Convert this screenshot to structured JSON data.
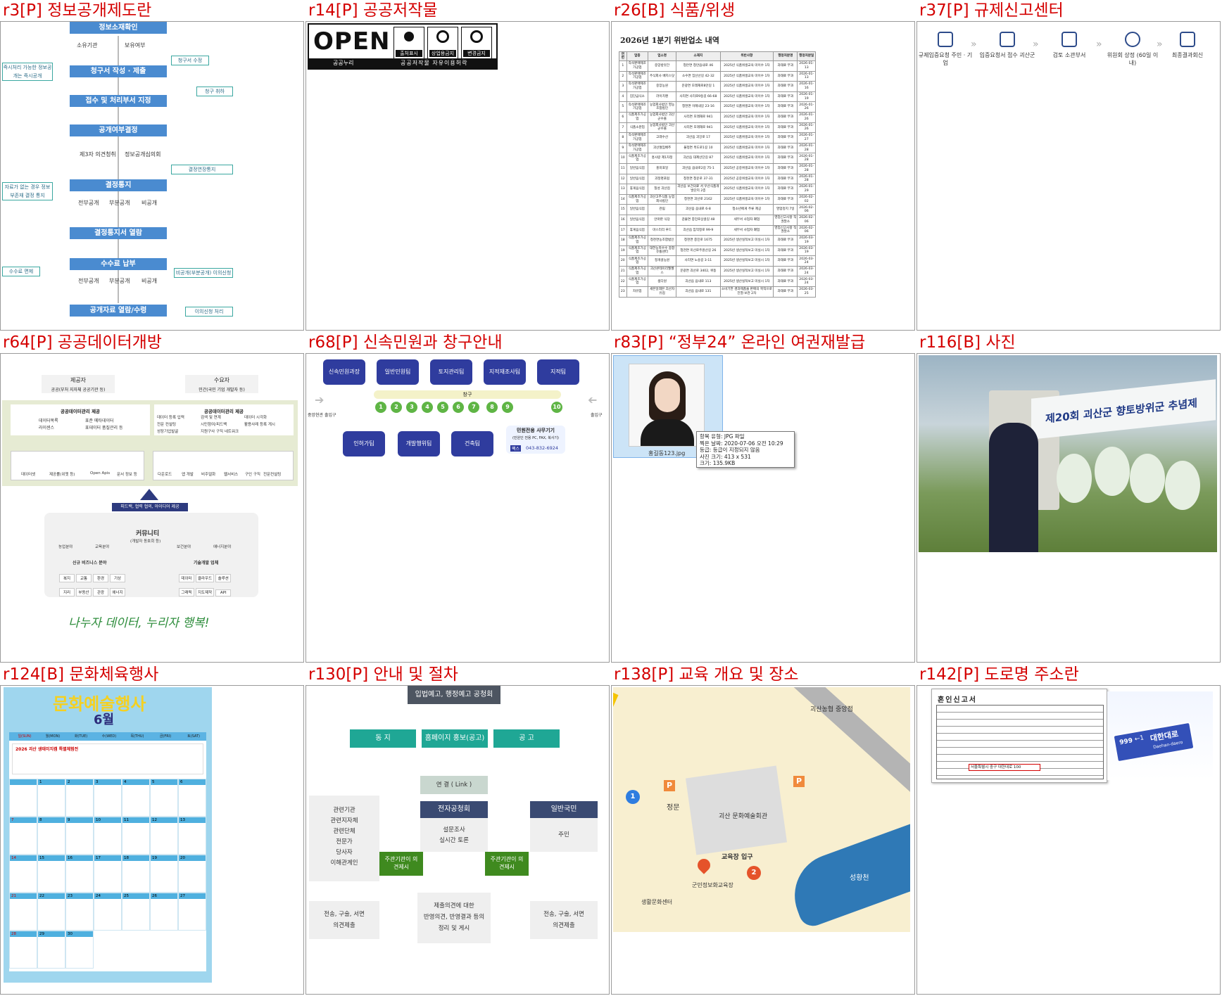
{
  "cells": {
    "r3": {
      "title": "r3[P] 정보공개제도란"
    },
    "r14": {
      "title": "r14[P] 공공저작물"
    },
    "r26": {
      "title": "r26[B] 식품/위생"
    },
    "r37": {
      "title": "r37[P] 규제신고센터"
    },
    "r64": {
      "title": "r64[P] 공공데이터개방"
    },
    "r68": {
      "title": "r68[P] 신속민원과 창구안내"
    },
    "r83": {
      "title": "r83[P] “정부24” 온라인 여권재발급"
    },
    "r116": {
      "title": "r116[B] 사진"
    },
    "r124": {
      "title": "r124[B] 문화체육행사"
    },
    "r130": {
      "title": "r130[P] 안내 및 절차"
    },
    "r138": {
      "title": "r138[P] 교육 개요 및 장소"
    },
    "r142": {
      "title": "r142[P] 도로명 주소란"
    }
  },
  "r3": {
    "steps": [
      "정보소재확인",
      "청구서 작성 · 제출",
      "접수 및 처리부서 지정",
      "공개여부결정",
      "결정통지",
      "결정통지서 열람",
      "수수료 납부",
      "공개자료 열람/수령"
    ],
    "sub1": [
      "소유기관",
      "보유여부"
    ],
    "sub2": [
      "제3자 의견청취",
      "정보공개심의회"
    ],
    "sub3": [
      "전부공개",
      "부분공개",
      "비공개"
    ],
    "sub4": [
      "전부공개",
      "부분공개",
      "비공개"
    ],
    "right": [
      "청구서 수정",
      "청구 취하",
      "결정연장통지",
      "비공개(부분공개) 이의신청",
      "이의신청 처리"
    ],
    "left": [
      "즉시처리 가능한 정보공개는 즉시공개",
      "자료가 없는 경우 정보부존재 결정 통지",
      "수수료 면제"
    ]
  },
  "r14": {
    "open": "OPEN",
    "nuri": "공공누리",
    "badges": [
      "출처표시",
      "상업용금지",
      "변경금지"
    ],
    "desc": "공공저작물 자유이용허락"
  },
  "r26": {
    "heading": "2026년 1분기 위반업소 내역",
    "headers": [
      "연번",
      "업종",
      "업소명",
      "소재지",
      "위반사항",
      "행정처분명",
      "행정처분일"
    ],
    "rows": [
      [
        "1",
        "즉석판매제조가공업",
        "중앙방앗간",
        "청안면 청안읍내로 46",
        "2025년 식품위생교육 미이수 1차",
        "과태료 부과",
        "2026-01-13"
      ],
      [
        "2",
        "즉석판매제조가공업",
        "주식회사 베지스닷",
        "소수면 집산산길 42-32",
        "2025년 식품위생교육 미이수 1차",
        "과태료 부과",
        "2026-01-13"
      ],
      [
        "3",
        "즉석판매제조가공업",
        "중앙농원",
        "문광면 모래재로8안길 1",
        "2025년 식품위생교육 미이수 1차",
        "과태료 부과",
        "2026-01-16"
      ],
      [
        "4",
        "집단급식소",
        "라이치랜",
        "사리면 사리로9동길 66-68",
        "2025년 식품위생교육 미이수 1차",
        "과태료 부과",
        "2026-01-19"
      ],
      [
        "5",
        "즉석판매제조가공업",
        "농업회사법인 영농조합법인",
        "청천면 이례내길 23-16",
        "2025년 식품위생교육 미이수 1차",
        "과태료 부과",
        "2026-01-26"
      ],
      [
        "6",
        "식품제조가공업",
        "농업회사법인 괴산군수출",
        "사리면 모래재로 941",
        "2025년 식품위생교육 미이수 1차",
        "과태료 부과",
        "2026-01-26"
      ],
      [
        "7",
        "식품소분업",
        "농업회사법인 괴산군수출",
        "사리면 모래재로 941",
        "2025년 식품위생교육 미이수 1차",
        "과태료 부과",
        "2026-01-26"
      ],
      [
        "8",
        "즉석판매제조가공업",
        "고래수산",
        "괴산읍 괴강로 17",
        "2025년 식품위생교육 미이수 1차",
        "과태료 부과",
        "2026-01-27"
      ],
      [
        "9",
        "즉석판매제조가공업",
        "괴산절임배추",
        "불정면 목도로1길 10",
        "2025년 식품위생교육 미이수 1차",
        "과태료 부과",
        "2026-01-28"
      ],
      [
        "10",
        "식품제조가공업",
        "홍사랑 제1차정",
        "괴산읍 대제산단길 87",
        "2025년 식품위생교육 미이수 1차",
        "과태료 부과",
        "2026-01-28"
      ],
      [
        "11",
        "일반음식점",
        "홍미표일",
        "괴산읍 읍내로2길 75-1",
        "2025년 공중위생교육 미이수 1차",
        "과태료 부과",
        "2026-01-28"
      ],
      [
        "12",
        "일반음식점",
        "괴정명포럼",
        "청천면 청운로 37-31",
        "2025년 공중위생교육 미이수 1차",
        "과태료 부과",
        "2026-01-28"
      ],
      [
        "13",
        "휴게음식점",
        "칠성 괴산점",
        "괴산읍 보건의료 서 우산식품개발단지 2층",
        "2025년 식품위생교육 미이수 1차",
        "과태료 부과",
        "2026-01-29"
      ],
      [
        "14",
        "식품제조가공업",
        "괴산고추식품 농업회사법인",
        "청천면 괴산로 2162",
        "2025년 식품위생교육 미이수 1차",
        "과태료 부과",
        "2026-02-02"
      ],
      [
        "15",
        "일반음식점",
        "관림",
        "괴산읍 읍내로 6-8",
        "청소년에게 주류 제공",
        "영업정지 7일",
        "2026-02-06"
      ],
      [
        "16",
        "일반음식점",
        "안마판 식당",
        "감물면 충민로상골길 48",
        "세무서 사업자 폐업",
        "영업신고사항 직권말소",
        "2026-02-06"
      ],
      [
        "17",
        "휴게음식점",
        "마스터리 푸드",
        "괴산읍 임꺽정로 99-9",
        "세무서 사업자 폐업",
        "영업신고사항 직권말소",
        "2026-02-06"
      ],
      [
        "18",
        "식품제조가공업",
        "청천면농조합법인",
        "청천면 충민로 1675",
        "2025년 생산실적보고 미실시 1차",
        "과태료 부과",
        "2026-03-19"
      ],
      [
        "19",
        "식품제조가공업",
        "대한농축수수 종합유통센터",
        "청천면 미선로주원산길 26",
        "2025년 생산실적보고 미실시 1차",
        "과태료 부과",
        "2026-03-19"
      ],
      [
        "20",
        "식품제조가공업",
        "정개골농원",
        "사리면 노송길 3-11",
        "2025년 생산실적보고 미실시 1차",
        "과태료 부과",
        "2026-03-24"
      ],
      [
        "21",
        "식품제조가공업",
        "괴산콘테미리멜젤스",
        "문광면 괴산로 3402, 위동",
        "2025년 생산실적보고 미실시 1차",
        "과태료 부과",
        "2026-03-24"
      ],
      [
        "22",
        "식품제조가공업",
        "샘다원",
        "괴산읍 읍내로 113",
        "2025년 생산실적보고 미실시 1차",
        "과태료 부과",
        "2026-03-24"
      ],
      [
        "23",
        "자유업",
        "세븐일레븐 괴산자유점",
        "괴산읍 읍내로 131",
        "소비기한 경과제품을 판매의 목적으로 진열·보관 2차",
        "과태료 부과",
        "2026-03-25"
      ]
    ]
  },
  "r37": {
    "steps": [
      "규제입증요청 주민 · 기업",
      "입증요청서 접수 괴산군",
      "검토 소관부서",
      "위원회 상정 (60일 이내)",
      "최종결과회신"
    ]
  },
  "r64": {
    "providers": "제공자",
    "providers_sub": "공공(부처 지자체 공공기관 등)",
    "users": "수요자",
    "users_sub": "민간(국민 기업 개발자 등)",
    "mgmt_title": "공공데이터관리 제공",
    "mgmt_items": [
      "데이터목록",
      "라이센스",
      "표준 메타데이터",
      "표데이터 품질관리 등"
    ],
    "use_title": "공공데이터관리 제공",
    "use_items": [
      "데이터 등록 입력",
      "검색 및 연계",
      "데이터 시각화",
      "전문 컨설팅",
      "시민참여/피드백",
      "활용사례 등록 게시",
      "성장기업발굴",
      "지원구사 구직 네트워크"
    ],
    "left_icons": [
      "데이터셋",
      "제공률(위젯 등)",
      "Open Apis",
      "문서 정보 등"
    ],
    "right_icons": [
      "다운로드",
      "앱 개발",
      "비주얼화",
      "웹서비스",
      "구인 구직",
      "전문컨설팅"
    ],
    "feedback": "피드백, 협력 협의, 아이디어 제공",
    "community": "커뮤니티",
    "community_sub": "(개발자 동호회 등)",
    "sectors": [
      "농업분야",
      "교육분야",
      "보건분야",
      "에너지분야"
    ],
    "biz_title": "신규 비즈니스 분야",
    "biz_items": [
      "복지",
      "교통",
      "환경",
      "기상",
      "지리",
      "부동산",
      "관광",
      "에너지"
    ],
    "tech_title": "기술개발 업체",
    "tech_items": [
      "데이터",
      "클라우드",
      "솔루션",
      "그래픽",
      "지도제작",
      "API"
    ],
    "slogan": "나누자 데이터, 누리자 행복!"
  },
  "r68": {
    "top": [
      "신속민원과장",
      "일반민원팀",
      "토지관리팀",
      "지적재조사팀",
      "지적팀"
    ],
    "window": "창구",
    "nums": [
      "1",
      "2",
      "3",
      "4",
      "5",
      "6",
      "7",
      "8",
      "9",
      "10"
    ],
    "left_exit": "중앙현관 출입구",
    "right_exit": "출입구",
    "bottom": [
      "인허가팀",
      "개발행위팀",
      "건축팀"
    ],
    "kiosk_title": "민원전용 사무기기",
    "kiosk_sub": "(민원인 전용 PC, FAX, 복사기)",
    "fax_label": "팩스",
    "fax": "043-832-6924"
  },
  "r83": {
    "filename": "홍길동123.jpg",
    "tooltip": [
      "항목 유형: JPG 파일",
      "찍은 날짜: 2020-07-06 오전 10:29",
      "등급: 등급이 지정되지 않음",
      "사진 크기: 413 x 531",
      "크기: 135.9KB"
    ]
  },
  "r116": {
    "banner": "제20회 괴산군 향토방위군 추념제"
  },
  "r124": {
    "title": "문화예술행사",
    "month": "6월",
    "days": [
      "일(SUN)",
      "월(MON)",
      "화(TUE)",
      "수(WED)",
      "목(THU)",
      "금(FRI)",
      "토(SAT)"
    ],
    "notice": "2026 괴산 생태미지캠 특별체험전",
    "dates": [
      "",
      "1",
      "2",
      "3",
      "4",
      "5",
      "6",
      "7",
      "8",
      "9",
      "10",
      "11",
      "12",
      "13",
      "14",
      "15",
      "16",
      "17",
      "18",
      "19",
      "20",
      "21",
      "22",
      "23",
      "24",
      "25",
      "26",
      "27",
      "28",
      "29",
      "30"
    ]
  },
  "r130": {
    "top": "입법예고, 행정예고 공청회",
    "row1": [
      "동 지",
      "홈페이지 홍보(공고)",
      "공 고"
    ],
    "link": "연 결 ( Link )",
    "left_list": [
      "관련기관",
      "관련지자체",
      "관련단체",
      "전문가",
      "당사자",
      "이해관계인"
    ],
    "center_title": "전자공청회",
    "center_body": [
      "설문조사",
      "실시간 토론"
    ],
    "right_title": "일반국민",
    "right_body": "주민",
    "green": [
      "주관기관이 의견제시",
      "주관기관이 의견제시"
    ],
    "bottom_left": [
      "전송, 구술, 서면",
      "의견제출"
    ],
    "bottom_center": [
      "제출의견에 대한",
      "반영의견, 반영결과 등의",
      "정리 및 게시"
    ],
    "bottom_right": [
      "전송, 구술, 서면",
      "의견제출"
    ]
  },
  "r138": {
    "labels": [
      "괴산농협 중앙점",
      "정문",
      "괴산 문화예술회관",
      "교육장 입구",
      "군민정보화교육장",
      "생활문화센터",
      "성황천"
    ],
    "pins": [
      "1",
      "2"
    ],
    "parking": "P"
  },
  "r142": {
    "form_title": "혼인신고서",
    "sign_num": "999",
    "sign_road": "대한대로",
    "sign_en": "Daehan-daero",
    "addr": "서울특별시 중구 대한대로 100"
  },
  "colors": {
    "title_red": "#d40000",
    "flow_blue": "#4a8bd0",
    "teal": "#1fa795",
    "navy": "#2f3c9e"
  }
}
